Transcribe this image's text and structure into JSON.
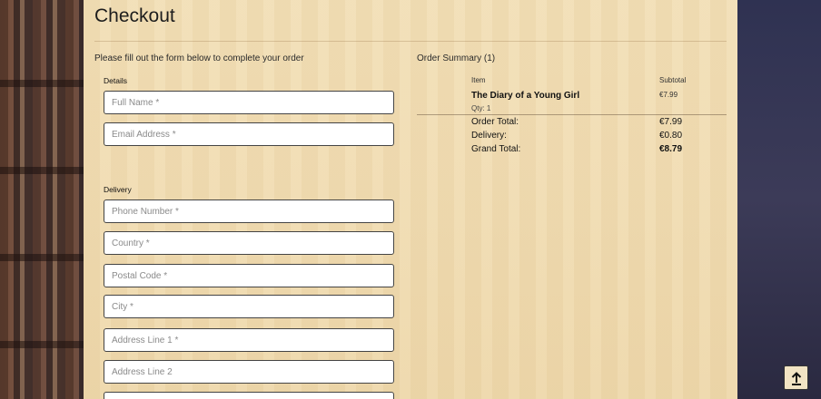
{
  "page": {
    "title": "Checkout",
    "intro": "Please fill out the form below to complete your order"
  },
  "details": {
    "label": "Details",
    "full_name_placeholder": "Full Name *",
    "email_placeholder": "Email Address *"
  },
  "delivery": {
    "label": "Delivery",
    "phone_placeholder": "Phone Number *",
    "country_placeholder": "Country *",
    "postal_placeholder": "Postal Code *",
    "city_placeholder": "City *",
    "address1_placeholder": "Address Line 1 *",
    "address2_placeholder": "Address Line 2"
  },
  "summary": {
    "title": "Order Summary (1)",
    "item_header": "Item",
    "subtotal_header": "Subtotal",
    "items": [
      {
        "name": "The Diary of a Young Girl",
        "qty": "Qty: 1",
        "subtotal": "€7.99"
      }
    ],
    "order_total_label": "Order Total:",
    "order_total": "€7.99",
    "delivery_label": "Delivery:",
    "delivery_value": "€0.80",
    "grand_total_label": "Grand Total:",
    "grand_total": "€8.79"
  },
  "scroll_top_icon": "arrow-up-to-line-icon"
}
